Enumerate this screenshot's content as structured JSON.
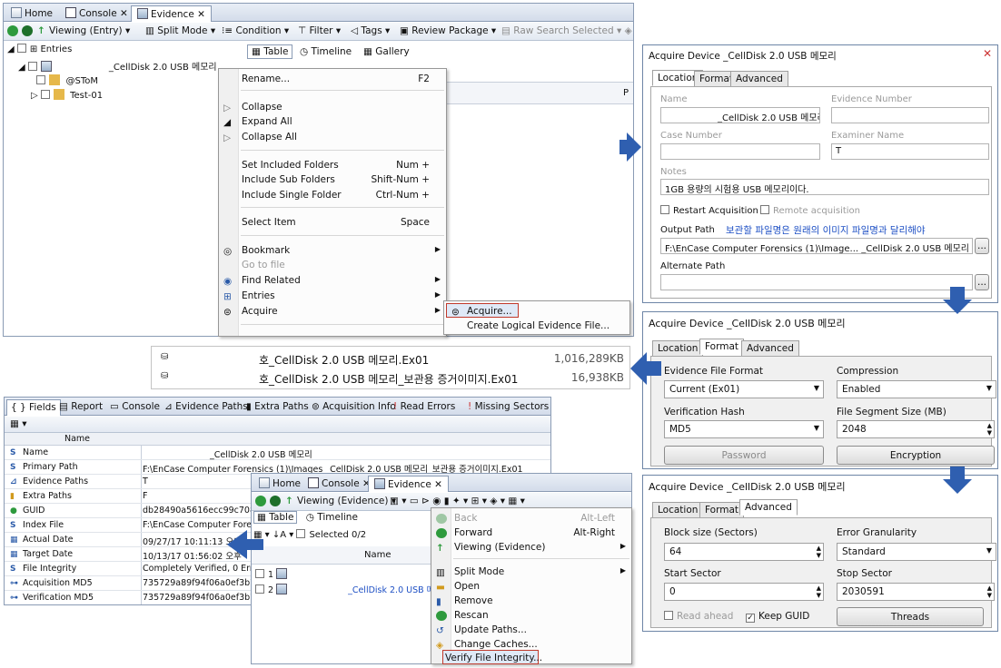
{
  "main_window": {
    "tabs": [
      "Home",
      "Console",
      "Evidence"
    ],
    "toolbar": [
      "Viewing (Entry)",
      "Split Mode",
      "Condition",
      "Filter",
      "Tags",
      "Review Package",
      "Raw Search Selected"
    ],
    "tree": {
      "root": "Entries",
      "device": "_CellDisk 2.0 USB 메모리",
      "children": [
        "@SToM",
        "Test-01"
      ]
    },
    "view_tabs": [
      "Table",
      "Timeline",
      "Gallery"
    ],
    "col_header_right": "P"
  },
  "context_menu": {
    "items": [
      {
        "label": "Rename...",
        "shortcut": "F2"
      },
      {
        "label": "Collapse",
        "shortcut": ""
      },
      {
        "label": "Expand All",
        "shortcut": ""
      },
      {
        "label": "Collapse All",
        "shortcut": ""
      },
      {
        "label": "Set Included Folders",
        "shortcut": "Num +"
      },
      {
        "label": "Include Sub Folders",
        "shortcut": "Shift-Num +"
      },
      {
        "label": "Include Single Folder",
        "shortcut": "Ctrl-Num +"
      },
      {
        "label": "Select Item",
        "shortcut": "Space"
      },
      {
        "label": "Bookmark",
        "shortcut": ""
      },
      {
        "label": "Go to file",
        "shortcut": ""
      },
      {
        "label": "Find Related",
        "shortcut": ""
      },
      {
        "label": "Entries",
        "shortcut": ""
      },
      {
        "label": "Acquire",
        "shortcut": ""
      }
    ],
    "submenu": [
      "Acquire...",
      "Create Logical Evidence File..."
    ]
  },
  "acquire_location": {
    "title": "Acquire Device _CellDisk 2.0 USB 메모리",
    "tabs": [
      "Location",
      "Format",
      "Advanced"
    ],
    "name_label": "Name",
    "name_value": "_CellDisk 2.0 USB 메모리",
    "evidence_number_label": "Evidence Number",
    "case_number_label": "Case Number",
    "examiner_name_label": "Examiner Name",
    "examiner_value": "T",
    "notes_label": "Notes",
    "notes_value": "1GB 용량의 시험용 USB 메모리이다.",
    "restart_label": "Restart Acquisition",
    "remote_label": "Remote acquisition",
    "output_path_label": "Output Path",
    "annotation": "보관할 파일명은 원래의 이미지 파일명과 달리해야",
    "output_path_value": "F:\\EnCase Computer Forensics (1)\\Image... _CellDisk 2.0 USB 메모리",
    "alternate_path_label": "Alternate Path",
    "browse": "..."
  },
  "acquire_format": {
    "title": "Acquire Device _CellDisk 2.0 USB 메모리",
    "tabs": [
      "Location",
      "Format",
      "Advanced"
    ],
    "evidence_file_format_label": "Evidence File Format",
    "evidence_file_format_value": "Current (Ex01)",
    "compression_label": "Compression",
    "compression_value": "Enabled",
    "verification_hash_label": "Verification Hash",
    "verification_hash_value": "MD5",
    "file_segment_label": "File Segment Size (MB)",
    "file_segment_value": "2048",
    "password_button": "Password",
    "encryption_button": "Encryption"
  },
  "acquire_advanced": {
    "title": "Acquire Device _CellDisk 2.0 USB 메모리",
    "tabs": [
      "Location",
      "Format",
      "Advanced"
    ],
    "block_size_label": "Block size (Sectors)",
    "block_size_value": "64",
    "error_granularity_label": "Error Granularity",
    "error_granularity_value": "Standard",
    "start_sector_label": "Start Sector",
    "start_sector_value": "0",
    "stop_sector_label": "Stop Sector",
    "stop_sector_value": "2030591",
    "read_ahead_label": "Read ahead",
    "keep_guid_label": "Keep GUID",
    "threads_button": "Threads"
  },
  "file_list": [
    {
      "name": "호_CellDisk 2.0 USB 메모리.Ex01",
      "size": "1,016,289KB"
    },
    {
      "name": "호_CellDisk 2.0 USB 메모리_보관용 증거이미지.Ex01",
      "size": "16,938KB"
    }
  ],
  "fields_panel": {
    "tabs": [
      "Fields",
      "Report",
      "Console",
      "Evidence Paths",
      "Extra Paths",
      "Acquisition Info",
      "Read Errors",
      "Missing Sectors"
    ],
    "header": "Name",
    "rows": [
      {
        "k": "Name",
        "v": "_CellDisk 2.0 USB 메모리"
      },
      {
        "k": "Primary Path",
        "v": "F:\\EnCase Computer Forensics (1)\\Images _CellDisk 2.0 USB 메모리_보관용 증거이미지.Ex01"
      },
      {
        "k": "Evidence Paths",
        "v": "T"
      },
      {
        "k": "Extra Paths",
        "v": "F"
      },
      {
        "k": "GUID",
        "v": "db28490a5616ecc99c7080c9e"
      },
      {
        "k": "Index File",
        "v": "F:\\EnCase Computer Forensics"
      },
      {
        "k": "Actual Date",
        "v": "09/27/17 10:11:13 오후"
      },
      {
        "k": "Target Date",
        "v": "10/13/17 01:56:02 오후"
      },
      {
        "k": "File Integrity",
        "v": "Completely Verified, 0 Errors"
      },
      {
        "k": "Acquisition MD5",
        "v": "735729a89f94f06a0ef3b70d2"
      },
      {
        "k": "Verification MD5",
        "v": "735729a89f94f06a0ef3b70d2"
      }
    ]
  },
  "evidence_window": {
    "tabs": [
      "Home",
      "Console",
      "Evidence"
    ],
    "toolbar": "Viewing (Evidence)",
    "view_tabs": [
      "Table",
      "Timeline"
    ],
    "selected": "Selected 0/2",
    "col_name": "Name",
    "rows": [
      {
        "num": "1",
        "name": ""
      },
      {
        "num": "2",
        "name": "_CellDisk 2.0 USB 메모"
      }
    ]
  },
  "evidence_menu": {
    "items": [
      {
        "label": "Back",
        "shortcut": "Alt-Left"
      },
      {
        "label": "Forward",
        "shortcut": "Alt-Right"
      },
      {
        "label": "Viewing (Evidence)",
        "shortcut": ""
      },
      {
        "label": "Split Mode",
        "shortcut": ""
      },
      {
        "label": "Open",
        "shortcut": ""
      },
      {
        "label": "Remove",
        "shortcut": ""
      },
      {
        "label": "Rescan",
        "shortcut": ""
      },
      {
        "label": "Update Paths...",
        "shortcut": ""
      },
      {
        "label": "Change Caches...",
        "shortcut": ""
      },
      {
        "label": "Verify File Integrity...",
        "shortcut": ""
      }
    ]
  },
  "colors": {
    "arrow": "#2f5fb0",
    "highlight": "#c0392b",
    "annotation": "#1d4fc4"
  }
}
